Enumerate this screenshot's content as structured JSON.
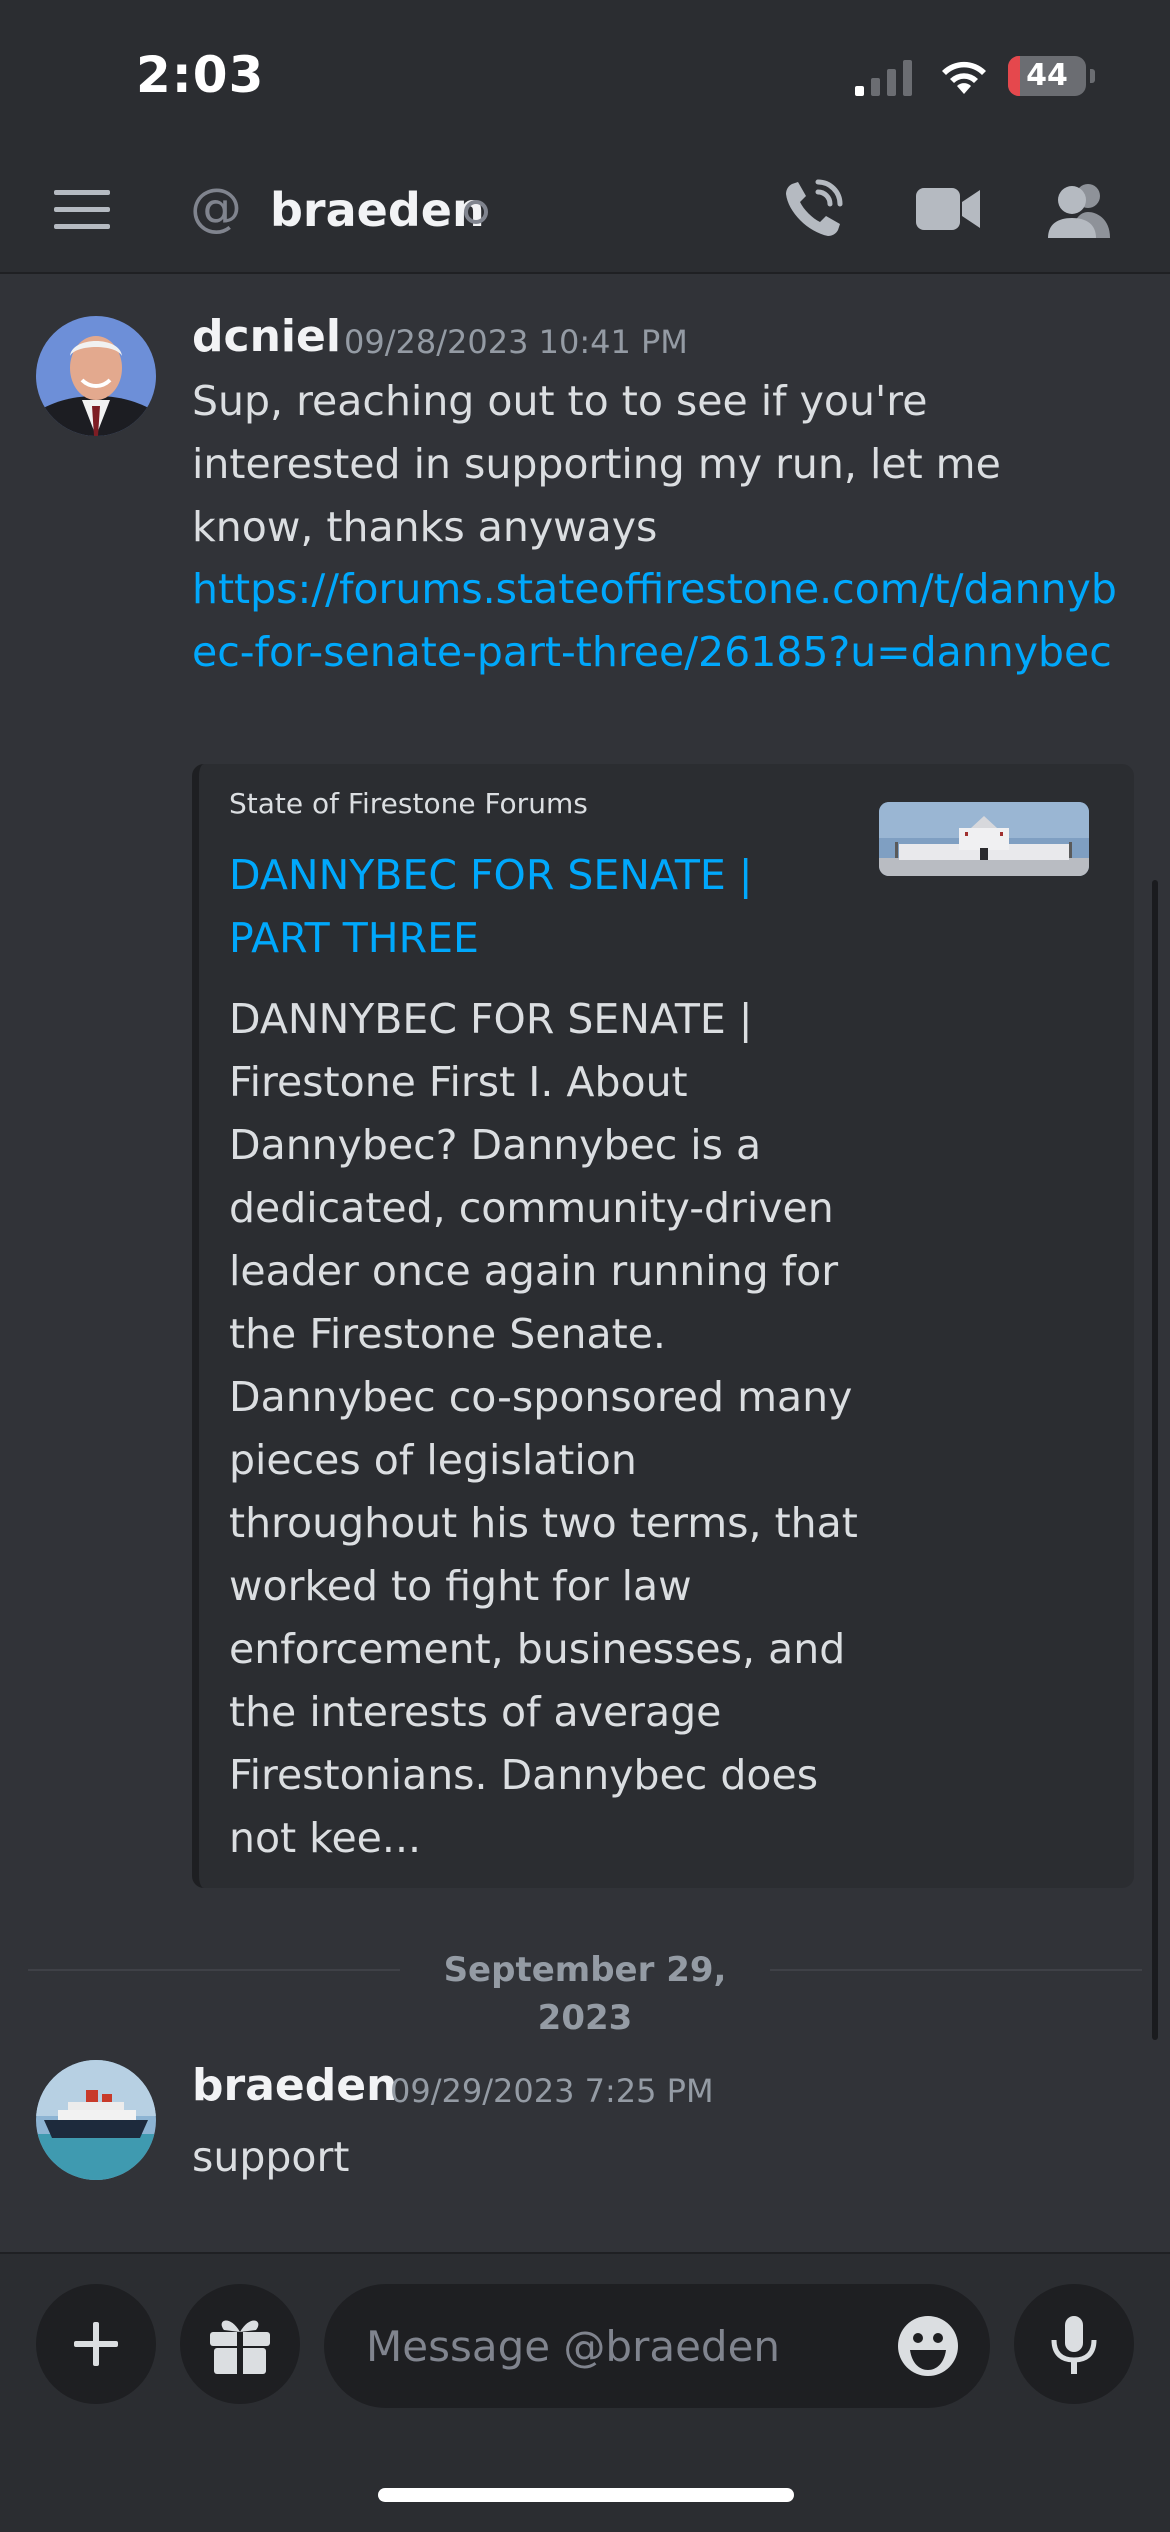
{
  "status_bar": {
    "time": "2:03",
    "battery": "44",
    "battery_level": 0.15
  },
  "header": {
    "at_symbol": "@",
    "channel_name": "braeden",
    "icons": [
      "menu-icon",
      "at-icon",
      "call-icon",
      "video-icon",
      "members-icon"
    ]
  },
  "messages": [
    {
      "author": "dcniel",
      "timestamp": "09/28/2023 10:41 PM",
      "text": "Sup, reaching out to to see if you're interested in supporting my run, let me know, thanks anyways",
      "link": "https://forums.stateoffirestone.com/t/dannybec-for-senate-part-three/26185?u=dannybec",
      "embed": {
        "provider": "State of Firestone Forums",
        "title": "DANNYBEC FOR SENATE | PART THREE",
        "description": "DANNYBEC FOR SENATE | Firestone First   I. About Dannybec?  Dannybec is a dedicated, community-driven leader once again running for the Firestone Senate. Dannybec co-sponsored many pieces of legislation throughout his two terms, that worked to fight for law enforcement, businesses, and the interests of average Firestonians. Dannybec does not kee..."
      }
    },
    {
      "author": "braeden",
      "timestamp": "09/29/2023 7:25 PM",
      "text": "support"
    }
  ],
  "date_divider": "September 29, 2023",
  "composer": {
    "placeholder": "Message @braeden"
  },
  "colors": {
    "background": "#313338",
    "header_bg": "#2b2d31",
    "link": "#00a8fc",
    "embed_bg": "#2b2d31",
    "input_bg": "#1e1f22"
  }
}
